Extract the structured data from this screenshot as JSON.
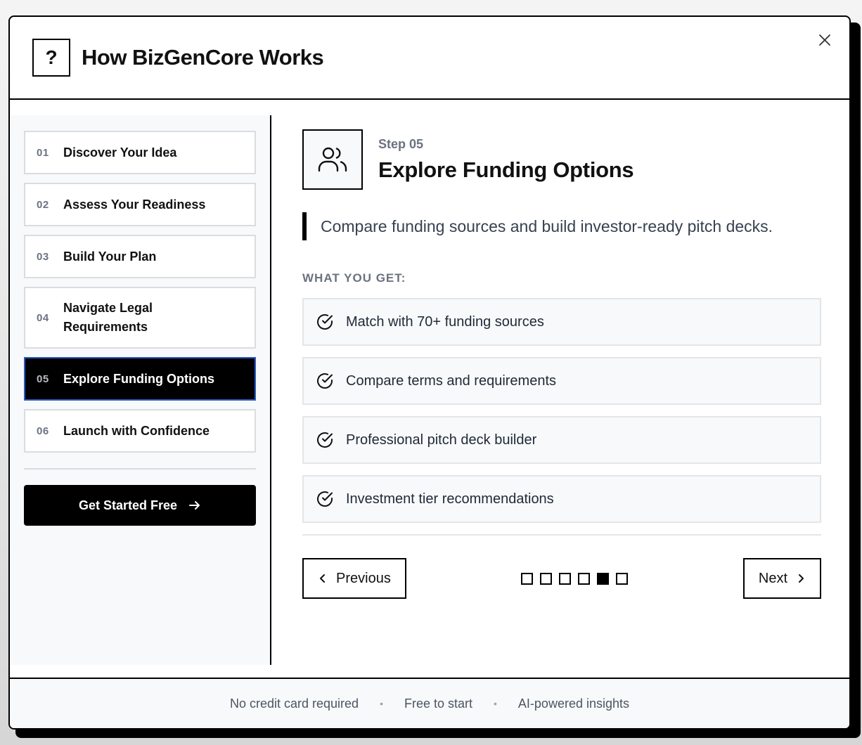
{
  "header": {
    "help_symbol": "?",
    "title": "How BizGenCore Works"
  },
  "sidebar": {
    "steps": [
      {
        "num": "01",
        "label": "Discover Your Idea"
      },
      {
        "num": "02",
        "label": "Assess Your Readiness"
      },
      {
        "num": "03",
        "label": "Build Your Plan"
      },
      {
        "num": "04",
        "label": "Navigate Legal Requirements"
      },
      {
        "num": "05",
        "label": "Explore Funding Options"
      },
      {
        "num": "06",
        "label": "Launch with Confidence"
      }
    ],
    "active_step": 5,
    "cta_label": "Get Started Free"
  },
  "main": {
    "kicker": "Step 05",
    "title": "Explore Funding Options",
    "icon": "users-icon",
    "description": "Compare funding sources and build investor-ready pitch decks.",
    "section_label": "WHAT YOU GET:",
    "features": [
      "Match with 70+ funding sources",
      "Compare terms and requirements",
      "Professional pitch deck builder",
      "Investment tier recommendations"
    ],
    "prev_label": "Previous",
    "next_label": "Next",
    "pagination": {
      "total": 6,
      "current": 5
    }
  },
  "footer": {
    "items": [
      "No credit card required",
      "Free to start",
      "AI-powered insights"
    ],
    "separator": "•"
  },
  "colors": {
    "accent": "#000000",
    "active_border": "#2b59c3",
    "panel_bg": "#f8f9fa"
  }
}
